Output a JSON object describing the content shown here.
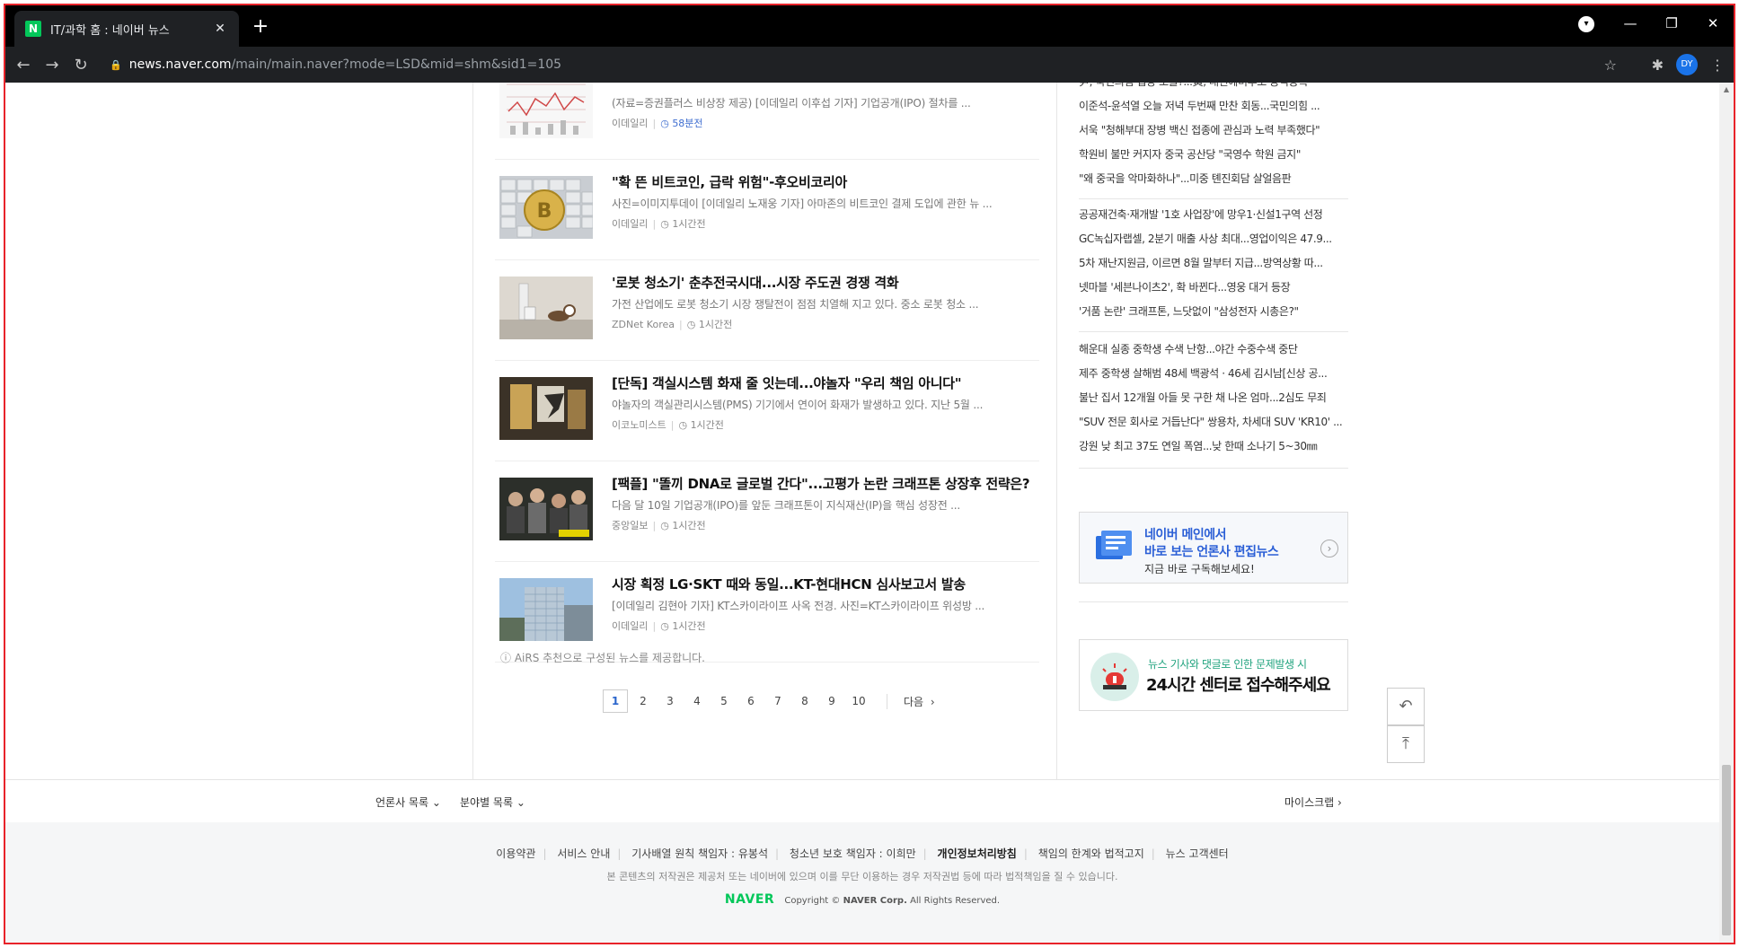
{
  "browser": {
    "tab_title": "IT/과학 홈 : 네이버 뉴스",
    "favicon_letter": "N",
    "url_host": "news.naver.com",
    "url_path": "/main/main.naver?mode=LSD&mid=shm&sid1=105",
    "profile_initials": "DY"
  },
  "articles": [
    {
      "title": "",
      "desc": "(자료=증권플러스 비상장 제공) [이데일리 이후섭 기자] 기업공개(IPO) 절차를 ...",
      "press": "이데일리",
      "time": "58분전",
      "time_blue": true,
      "thumb": "chart"
    },
    {
      "title": "\"확 뜬 비트코인, 급락 위험\"-후오비코리아",
      "desc": "사진=이미지투데이 [이데일리 노재웅 기자] 아마존의 비트코인 결제 도입에 관한 뉴 ...",
      "press": "이데일리",
      "time": "1시간전",
      "time_blue": false,
      "thumb": "bitcoin"
    },
    {
      "title": "'로봇 청소기' 춘추전국시대...시장 주도권 경쟁 격화",
      "desc": "가전 산업에도 로봇 청소기 시장 쟁탈전이 점점 치열해 지고 있다. 중소 로봇 청소 ...",
      "press": "ZDNet Korea",
      "time": "1시간전",
      "time_blue": false,
      "thumb": "robot"
    },
    {
      "title": "[단독] 객실시스템 화재 줄 잇는데...야놀자 \"우리 책임 아니다\"",
      "desc": "야놀자의 객실관리시스템(PMS) 기기에서 연이어 화재가 발생하고 있다. 지난 5월 ...",
      "press": "이코노미스트",
      "time": "1시간전",
      "time_blue": false,
      "thumb": "fire"
    },
    {
      "title": "[팩플] \"똘끼 DNA로 글로벌 간다\"...고평가 논란 크래프톤 상장후 전략은?",
      "desc": "다음 달 10일 기업공개(IPO)를 앞둔 크래프톤이 지식재산(IP)을 핵심 성장전 ...",
      "press": "중앙일보",
      "time": "1시간전",
      "time_blue": false,
      "thumb": "people"
    },
    {
      "title": "시장 획정 LG·SKT 때와 동일...KT-현대HCN 심사보고서 발송",
      "desc": "[이데일리 김현아 기자] KT스카이라이프 사옥 전경. 사진=KT스카이라이프 위성방 ...",
      "press": "이데일리",
      "time": "1시간전",
      "time_blue": false,
      "thumb": "building"
    }
  ],
  "airs_note": "AiRS 추천으로 구성된 뉴스를 제공합니다.",
  "pager": {
    "pages": [
      "1",
      "2",
      "3",
      "4",
      "5",
      "6",
      "7",
      "8",
      "9",
      "10"
    ],
    "current": "1",
    "next": "다음"
  },
  "right_groups": [
    [
      "尹, 국민의힘 입당 조율?...黃, 대선예비후보 공식등록",
      "이준석-윤석열 오늘 저녁 두번째 만찬 회동...국민의힘 ...",
      "서욱 \"청해부대 장병 백신 접종에 관심과 노력 부족했다\"",
      "학원비 불만 커지자 중국 공산당 \"국영수 학원 금지\"",
      "\"왜 중국을 악마화하나\"...미중 톈진회담 살얼음판"
    ],
    [
      "공공재건축·재개발 '1호 사업장'에 망우1·신설1구역 선정",
      "GC녹십자랩셀, 2분기 매출 사상 최대...영업이익은 47.9...",
      "5차 재난지원금, 이르면 8월 말부터 지급...방역상황 따...",
      "넷마블 '세븐나이츠2', 확 바뀐다...영웅 대거 등장",
      "'거품 논란' 크래프톤, 느닷없이 \"삼성전자 시총은?\""
    ],
    [
      "해운대 실종 중학생 수색 난항...야간 수중수색 중단",
      "제주 중학생 살해범 48세 백광석 · 46세 김시남[신상 공...",
      "불난 집서 12개월 아들 못 구한 채 나온 엄마...2심도 무죄",
      "\"SUV 전문 회사로 거듭난다\" 쌍용차, 차세대 SUV 'KR10' ...",
      "강원 낮 최고 37도 연일 폭염...낮 한때 소나기 5~30㎜"
    ]
  ],
  "promo1": {
    "line1": "네이버 메인에서",
    "line2": "바로 보는 언론사 편집뉴스",
    "line3": "지금 바로 구독해보세요!"
  },
  "promo2": {
    "line1": "뉴스 기사와 댓글로 인한 문제발생 시",
    "line2": "24시간 센터로 접수해주세요"
  },
  "footer_top": {
    "press_list": "언론사 목록",
    "section_list": "분야별 목록",
    "my_scrap": "마이스크랩"
  },
  "footer": {
    "links": [
      "이용약관",
      "서비스 안내",
      "기사배열 원칙 책임자 : 유봉석",
      "청소년 보호 책임자 : 이희만",
      "개인정보처리방침",
      "책임의 한계와 법적고지",
      "뉴스 고객센터"
    ],
    "note": "본 콘텐츠의 저작권은 제공처 또는 네이버에 있으며 이를 무단 이용하는 경우 저작권법 등에 따라 법적책임을 질 수 있습니다.",
    "brand": "NAVER",
    "copyright_prefix": "Copyright ©",
    "copyright_corp": "NAVER Corp.",
    "copyright_suffix": "All Rights Reserved."
  },
  "colors": {
    "naver_green": "#03c75a",
    "link_blue": "#2b5fd6",
    "frame_red": "#e8232a"
  }
}
